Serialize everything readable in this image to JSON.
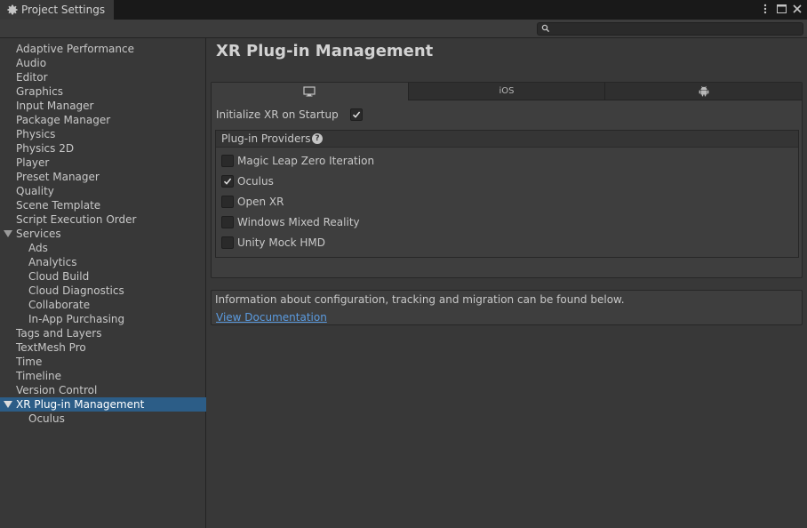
{
  "window": {
    "tab_title": "Project Settings",
    "icons": [
      "gear-icon",
      "kebab-menu-icon",
      "maximize-icon",
      "close-icon"
    ]
  },
  "toolbar": {
    "search_placeholder": ""
  },
  "sidebar": {
    "items": [
      {
        "label": "Adaptive Performance",
        "indent": 0
      },
      {
        "label": "Audio",
        "indent": 0
      },
      {
        "label": "Editor",
        "indent": 0
      },
      {
        "label": "Graphics",
        "indent": 0
      },
      {
        "label": "Input Manager",
        "indent": 0
      },
      {
        "label": "Package Manager",
        "indent": 0
      },
      {
        "label": "Physics",
        "indent": 0
      },
      {
        "label": "Physics 2D",
        "indent": 0
      },
      {
        "label": "Player",
        "indent": 0
      },
      {
        "label": "Preset Manager",
        "indent": 0
      },
      {
        "label": "Quality",
        "indent": 0
      },
      {
        "label": "Scene Template",
        "indent": 0
      },
      {
        "label": "Script Execution Order",
        "indent": 0
      },
      {
        "label": "Services",
        "indent": 0,
        "expanded": true
      },
      {
        "label": "Ads",
        "indent": 1
      },
      {
        "label": "Analytics",
        "indent": 1
      },
      {
        "label": "Cloud Build",
        "indent": 1
      },
      {
        "label": "Cloud Diagnostics",
        "indent": 1
      },
      {
        "label": "Collaborate",
        "indent": 1
      },
      {
        "label": "In-App Purchasing",
        "indent": 1
      },
      {
        "label": "Tags and Layers",
        "indent": 0
      },
      {
        "label": "TextMesh Pro",
        "indent": 0
      },
      {
        "label": "Time",
        "indent": 0
      },
      {
        "label": "Timeline",
        "indent": 0
      },
      {
        "label": "Version Control",
        "indent": 0
      },
      {
        "label": "XR Plug-in Management",
        "indent": 0,
        "expanded": true,
        "selected": true
      },
      {
        "label": "Oculus",
        "indent": 1
      }
    ]
  },
  "main": {
    "title": "XR Plug-in Management",
    "platform_tabs": [
      {
        "label": "",
        "icon": "desktop-icon",
        "active": true
      },
      {
        "label": "iOS",
        "icon": "",
        "active": false
      },
      {
        "label": "",
        "icon": "android-icon",
        "active": false
      }
    ],
    "init_on_startup": {
      "label": "Initialize XR on Startup",
      "checked": true
    },
    "providers": {
      "header": "Plug-in Providers",
      "help_glyph": "?",
      "items": [
        {
          "label": "Magic Leap Zero Iteration",
          "checked": false
        },
        {
          "label": "Oculus",
          "checked": true
        },
        {
          "label": "Open XR",
          "checked": false
        },
        {
          "label": "Windows Mixed Reality",
          "checked": false
        },
        {
          "label": "Unity Mock HMD",
          "checked": false
        }
      ]
    },
    "info": {
      "text": "Information about configuration, tracking and migration can be found below.",
      "link": "View Documentation"
    }
  },
  "colors": {
    "background": "#383838",
    "selection": "#2c5d87",
    "link": "#5b9be0"
  }
}
